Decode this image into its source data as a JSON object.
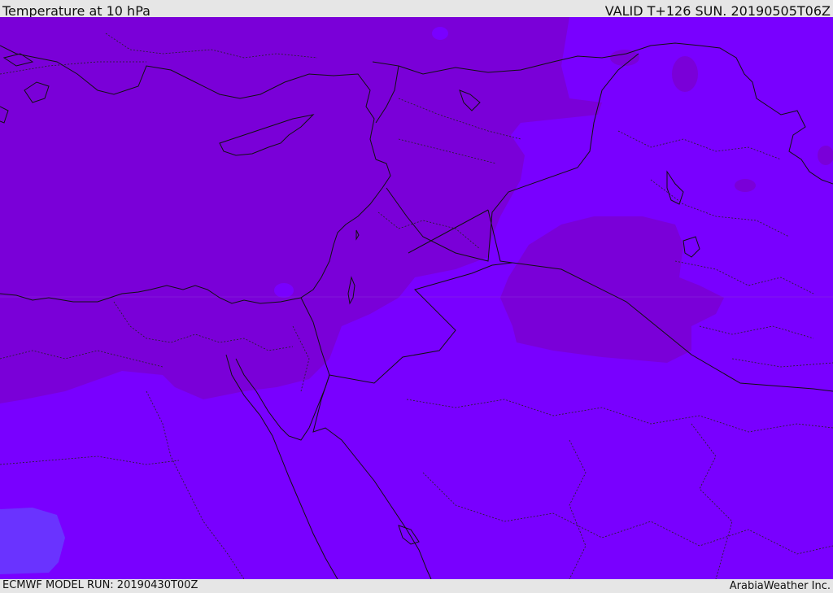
{
  "header": {
    "title": "Temperature at 10 hPa",
    "valid": "VALID T+126 SUN. 20190505T06Z"
  },
  "footer": {
    "model_run": "ECMWF MODEL RUN: 20190430T00Z",
    "credit": "ArabiaWeather Inc."
  },
  "map": {
    "region": "Eastern Mediterranean / Levant",
    "colors": {
      "warm_zone": "#7a00d8",
      "cool_zone": "#7900ff",
      "cold_patch": "#6a33ff",
      "borders": "#111111"
    }
  }
}
